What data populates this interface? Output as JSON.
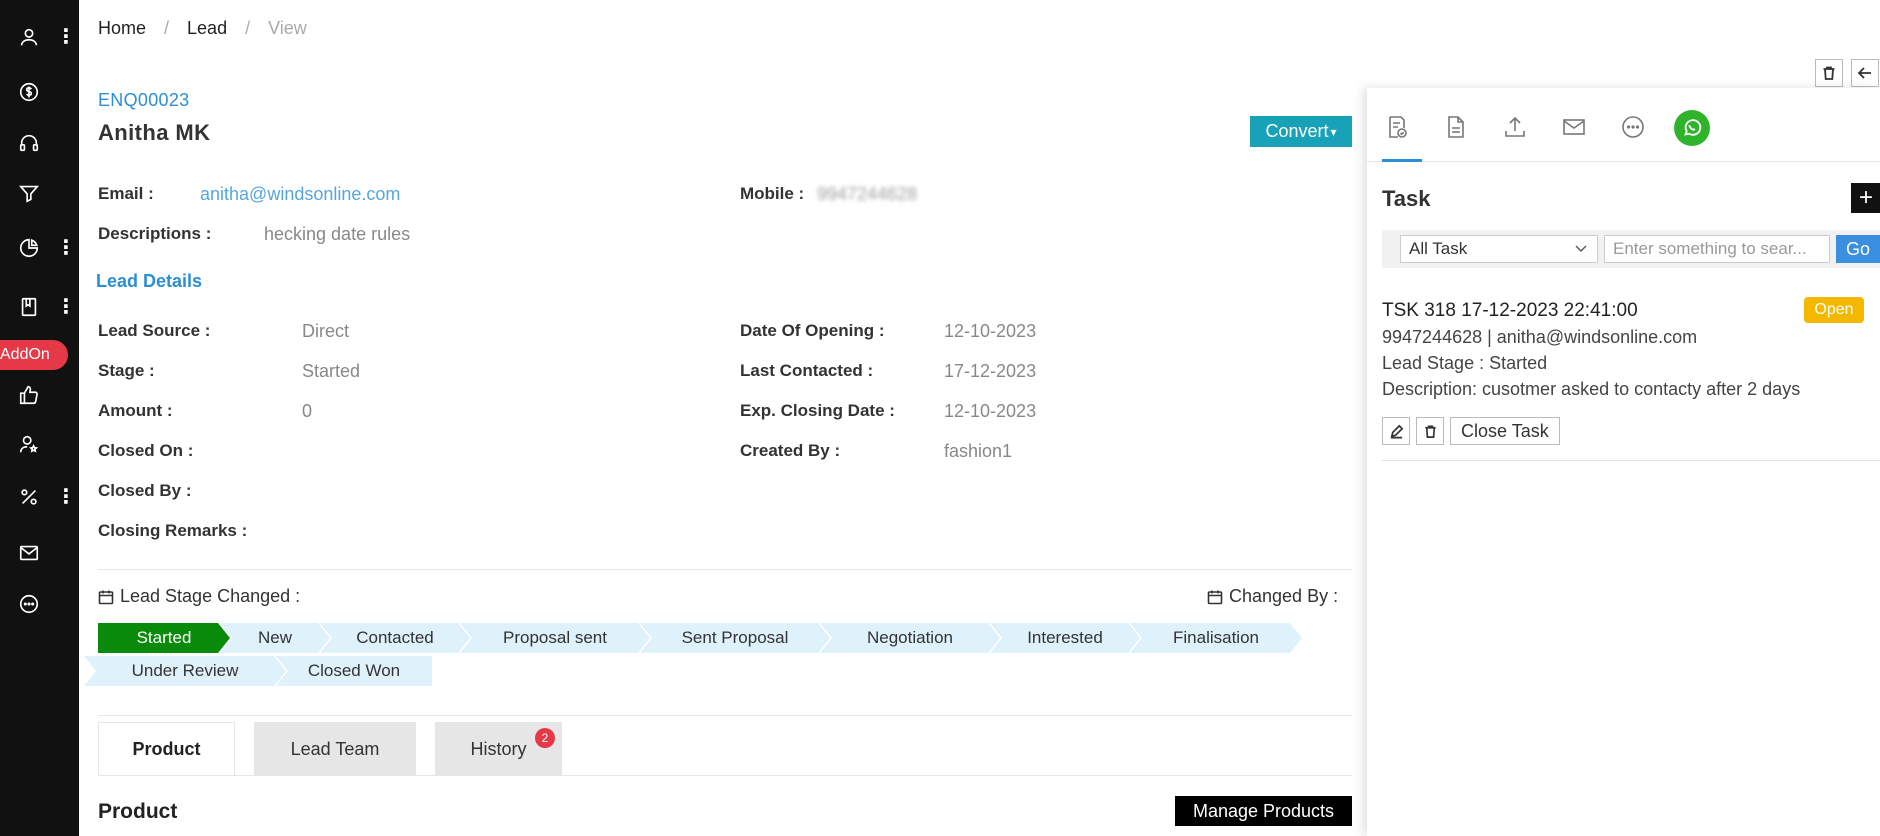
{
  "sidebar": {
    "addon_label": "AddOn",
    "items": [
      {
        "icon": "user-icon",
        "has_menu": true
      },
      {
        "icon": "dollar-icon",
        "has_menu": false
      },
      {
        "icon": "headset-icon",
        "has_menu": false
      },
      {
        "icon": "funnel-icon",
        "has_menu": false
      },
      {
        "icon": "pie-chart-icon",
        "has_menu": true
      },
      {
        "icon": "book-icon",
        "has_menu": true
      },
      {
        "icon": "thumbs-up-icon",
        "has_menu": false
      },
      {
        "icon": "user-star-icon",
        "has_menu": false
      },
      {
        "icon": "percent-icon",
        "has_menu": true
      },
      {
        "icon": "mail-icon",
        "has_menu": false
      },
      {
        "icon": "chat-icon",
        "has_menu": false
      }
    ]
  },
  "breadcrumb": {
    "home": "Home",
    "section": "Lead",
    "current": "View",
    "separator": "/"
  },
  "lead": {
    "id": "ENQ00023",
    "name": "Anitha MK",
    "convert_label": "Convert",
    "email_label": "Email :",
    "email_value": "anitha@windsonline.com",
    "mobile_label": "Mobile :",
    "mobile_value": "9947244628",
    "descriptions_label": "Descriptions :",
    "descriptions_value": "hecking date rules"
  },
  "details": {
    "section_title": "Lead Details",
    "left": [
      {
        "label": "Lead Source :",
        "value": "Direct"
      },
      {
        "label": "Stage :",
        "value": "Started"
      },
      {
        "label": "Amount :",
        "value": "0"
      },
      {
        "label": "Closed On :",
        "value": ""
      },
      {
        "label": "Closed By :",
        "value": ""
      },
      {
        "label": "Closing Remarks :",
        "value": ""
      }
    ],
    "right": [
      {
        "label": "Date Of Opening :",
        "value": "12-10-2023"
      },
      {
        "label": "Last Contacted :",
        "value": "17-12-2023"
      },
      {
        "label": "Exp. Closing Date :",
        "value": "12-10-2023"
      },
      {
        "label": "Created By :",
        "value": "fashion1"
      }
    ]
  },
  "stage_history": {
    "changed_label": "Lead Stage Changed :",
    "changed_by_label": "Changed By :",
    "stages": [
      "Started",
      "New",
      "Contacted",
      "Proposal sent",
      "Sent Proposal",
      "Negotiation",
      "Interested",
      "Finalisation",
      "Under Review",
      "Closed Won"
    ],
    "active_stage": "Started"
  },
  "tabs": [
    {
      "label": "Product",
      "active": true
    },
    {
      "label": "Lead Team",
      "active": false
    },
    {
      "label": "History",
      "active": false,
      "badge": "2"
    }
  ],
  "product": {
    "title": "Product",
    "manage_label": "Manage Products"
  },
  "task_panel": {
    "title": "Task",
    "add_label": "+",
    "filter_selected": "All Task",
    "search_placeholder": "Enter something to sear...",
    "go_label": "Go",
    "task": {
      "header": "TSK 318 17-12-2023 22:41:00",
      "status": "Open",
      "contact": "9947244628 | anitha@windsonline.com",
      "stage": "Lead Stage : Started",
      "description": "Description: cusotmer asked to contacty after 2 days",
      "close_label": "Close Task"
    }
  },
  "colors": {
    "accent": "#2c8fd6",
    "convert": "#17a2b8",
    "active_stage": "#0a8a0a",
    "stage_bg": "#dff1fb",
    "badge_red": "#e53947",
    "open_badge": "#f5b800",
    "whatsapp": "#2fb32b"
  }
}
